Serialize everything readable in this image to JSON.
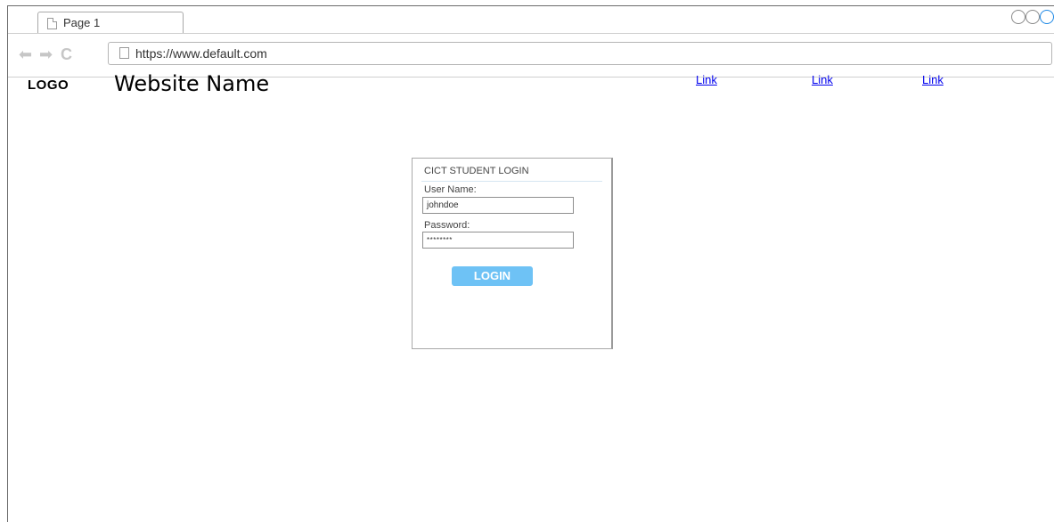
{
  "browser": {
    "tab_label": "Page 1",
    "url": "https://www.default.com"
  },
  "header": {
    "logo": "LOGO",
    "site_name": "Website Name",
    "links": [
      "Link",
      "Link",
      "Link"
    ]
  },
  "login": {
    "title": "CICT STUDENT LOGIN",
    "username_label": "User Name:",
    "username_value": "johndoe",
    "password_label": "Password:",
    "password_value": "********",
    "button_label": "LOGIN"
  },
  "colors": {
    "button": "#6ec2f5",
    "link": "#0000ee",
    "active_window_control": "#1e88e5"
  },
  "icons": [
    "page-icon",
    "back-arrow-icon",
    "forward-arrow-icon",
    "reload-icon",
    "window-control-icon"
  ]
}
